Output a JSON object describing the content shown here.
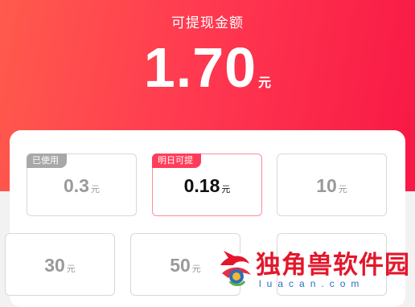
{
  "header": {
    "title": "可提现金额",
    "amount": "1.70",
    "unit": "元"
  },
  "options": [
    {
      "value": "0.3",
      "unit": "元",
      "badge": "已使用",
      "state": "used"
    },
    {
      "value": "0.18",
      "unit": "元",
      "badge": "明日可提",
      "state": "selected"
    },
    {
      "value": "10",
      "unit": "元",
      "badge": null,
      "state": "normal"
    },
    {
      "value": "30",
      "unit": "元",
      "badge": null,
      "state": "normal"
    },
    {
      "value": "50",
      "unit": "元",
      "badge": null,
      "state": "normal"
    }
  ],
  "watermark": {
    "brand": "独角兽软件园",
    "url": "luacan.com"
  },
  "colors": {
    "accent": "#ff3a50",
    "badge_used": "#a8a8a8",
    "badge_active": "#ff3d5a"
  }
}
